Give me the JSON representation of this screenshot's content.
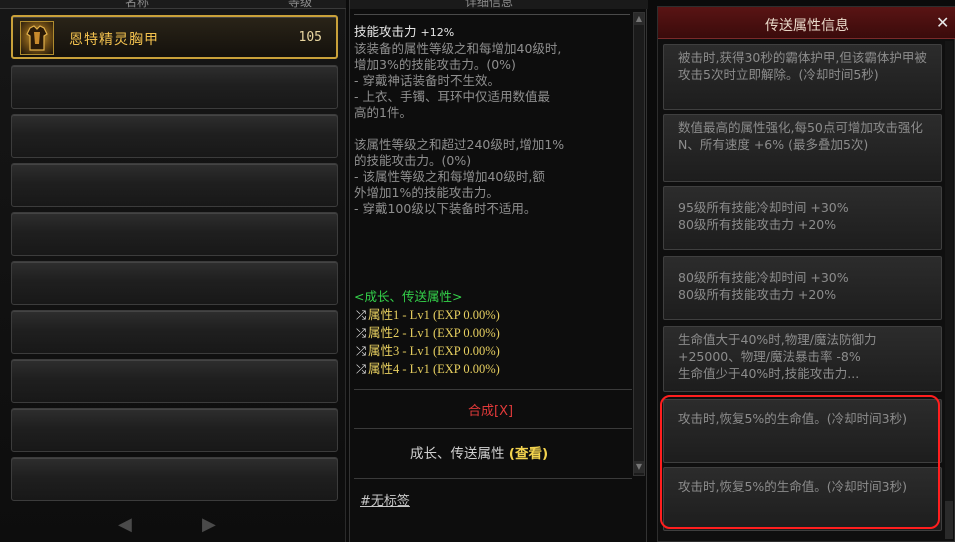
{
  "left_panel": {
    "header": {
      "col1": "名称",
      "col2": "等级"
    },
    "item": {
      "name": "恩特精灵胸甲",
      "level": "105",
      "icon": "armor-icon"
    },
    "nav": {
      "prev": "◀",
      "next": "▶"
    }
  },
  "middle_panel": {
    "header_title": "详细信息",
    "skill_title": "技能攻击力",
    "skill_bonus": "+12%",
    "desc_lines": [
      "该装备的属性等级之和每增加40级时,",
      "增加3%的技能攻击力。(0%)",
      "- 穿戴神话装备时不生效。",
      "- 上衣、手镯、耳环中仅适用数值最",
      "高的1件。",
      "",
      "该属性等级之和超过240级时,增加1%",
      "的技能攻击力。(0%)",
      "- 该属性等级之和每增加40级时,额",
      "外增加1%的技能攻击力。",
      "- 穿戴100级以下装备时不适用。"
    ],
    "growth_title": "<成长、传送属性>",
    "attributes": [
      {
        "label": "属性1 - Lv1 (EXP 0.00%)"
      },
      {
        "label": "属性2 - Lv1 (EXP 0.00%)"
      },
      {
        "label": "属性3 - Lv1 (EXP 0.00%)"
      },
      {
        "label": "属性4 - Lv1 (EXP 0.00%)"
      }
    ],
    "synth_link": "合成[X]",
    "growth_view_text": "成长、传送属性",
    "growth_view_link": "(查看)",
    "tag_link": "#无标签",
    "scroll_up": "▲",
    "scroll_down": "▼"
  },
  "right_panel": {
    "title": "传送属性信息",
    "close": "✕",
    "cards": [
      "被击时,获得30秒的霸体护甲,但该霸体护甲被攻击5次时立即解除。(冷却时间5秒)",
      "数值最高的属性强化,每50点可增加攻击强化 N、所有速度 +6% (最多叠加5次)",
      "95级所有技能冷却时间 +30%\n80级所有技能攻击力 +20%",
      "80级所有技能冷却时间 +30%\n80级所有技能攻击力 +20%",
      "生命值大于40%时,物理/魔法防御力 +25000、物理/魔法暴击率 -8%\n生命值少于40%时,技能攻击力...",
      "攻击时,恢复5%的生命值。(冷却时间3秒)",
      "攻击时,恢复5%的生命值。(冷却时间3秒)"
    ]
  },
  "colors": {
    "gold": "#f2c14e",
    "green": "#34d24a",
    "red_link": "#e03a3a",
    "highlight": "#ff1e1e",
    "header_red": "#5a1414"
  }
}
